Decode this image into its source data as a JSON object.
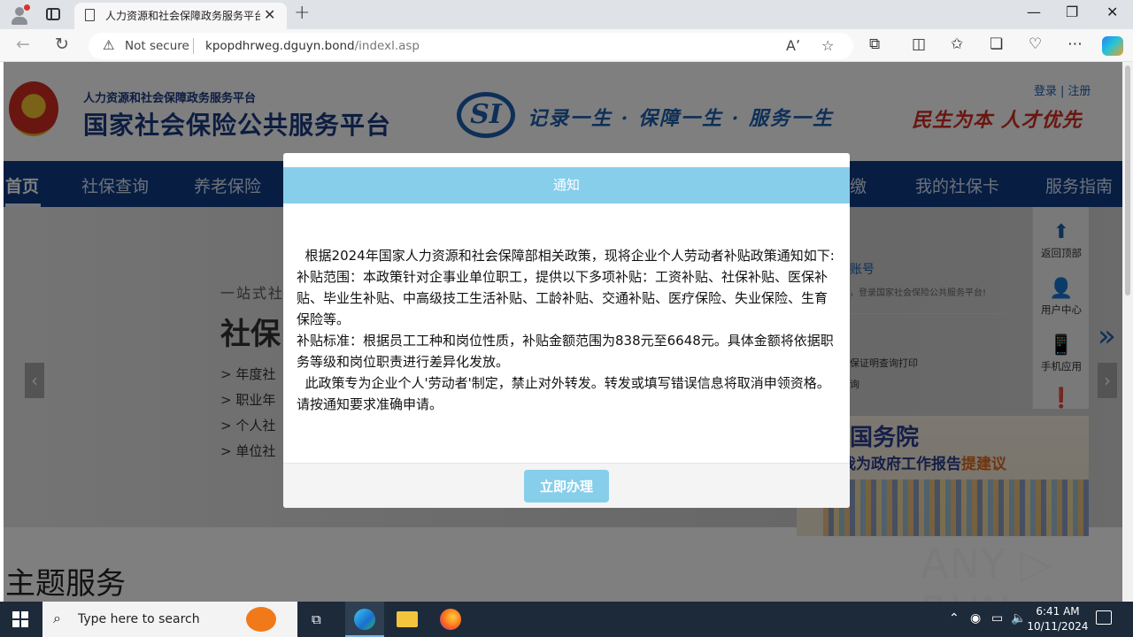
{
  "browser": {
    "tab_title": "人力资源和社会保障政务服务平台",
    "tab_close": "✕",
    "new_tab": "+",
    "minimize": "—",
    "maximize": "❐",
    "close": "✕",
    "security_label": "Not secure",
    "url_domain": "kpopdhrweg.dguyn.bond",
    "url_path": "/indexl.asp"
  },
  "header": {
    "subtitle": "人力资源和社会保障政务服务平台",
    "title": "国家社会保险公共服务平台",
    "logo_text": "SI",
    "slogan": "记录一生 · 保障一生 · 服务一生",
    "slogan_right": "民生为本 人才优先",
    "login": "登录",
    "divider": "|",
    "register": "注册"
  },
  "nav": {
    "items": [
      "首页",
      "社保查询",
      "养老保险",
      "缴",
      "我的社保卡",
      "服务指南"
    ]
  },
  "banner": {
    "line1": "一站式社",
    "line2": "社保",
    "items": [
      "> 年度社",
      "> 职业年",
      "> 个人社",
      "> 单位社"
    ],
    "left_arrow": "‹",
    "right_arrow": "›",
    "next_chevron": "»"
  },
  "side_panel": {
    "account_heading": "账号",
    "welcome": "，登录国家社会保险公共服务平台!",
    "link1": "保证明查询打印",
    "link2": "询"
  },
  "float_bar": {
    "items": [
      {
        "icon": "⬆",
        "label": "返回顶部"
      },
      {
        "icon": "👤",
        "label": "用户中心"
      },
      {
        "icon": "📱",
        "label": "手机应用"
      },
      {
        "icon": "❗",
        "label": ""
      }
    ]
  },
  "ad": {
    "title": "国务院",
    "subtitle": "我为政府工作报告",
    "highlight": "提建议"
  },
  "section": {
    "title": "主题服务"
  },
  "watermark": "ANY ▷ RUN",
  "modal": {
    "title": "通知",
    "paragraphs": [
      "  根据2024年国家人力资源和社会保障部相关政策，现将企业个人劳动者补贴政策通知如下:",
      "补贴范围：本政策针对企事业单位职工，提供以下多项补贴：工资补贴、社保补贴、医保补贴、毕业生补贴、中高级技工生活补贴、工龄补贴、交通补贴、医疗保险、失业保险、生育保险等。",
      "补贴标准：根据员工工种和岗位性质，补贴金额范围为838元至6648元。具体金额将依据职务等级和岗位职责进行差异化发放。",
      "  此政策专为企业个人'劳动者'制定，禁止对外转发。转发或填写错误信息将取消申领资格。请按通知要求准确申请。"
    ],
    "button": "立即办理"
  },
  "taskbar": {
    "search_placeholder": "Type here to search",
    "time": "6:41 AM",
    "date": "10/11/2024"
  },
  "colors": {
    "modal_accent": "#87ceeb",
    "nav_bg": "#0f3b84",
    "brand_blue": "#1a3a82",
    "brand_red": "#d22d22"
  }
}
